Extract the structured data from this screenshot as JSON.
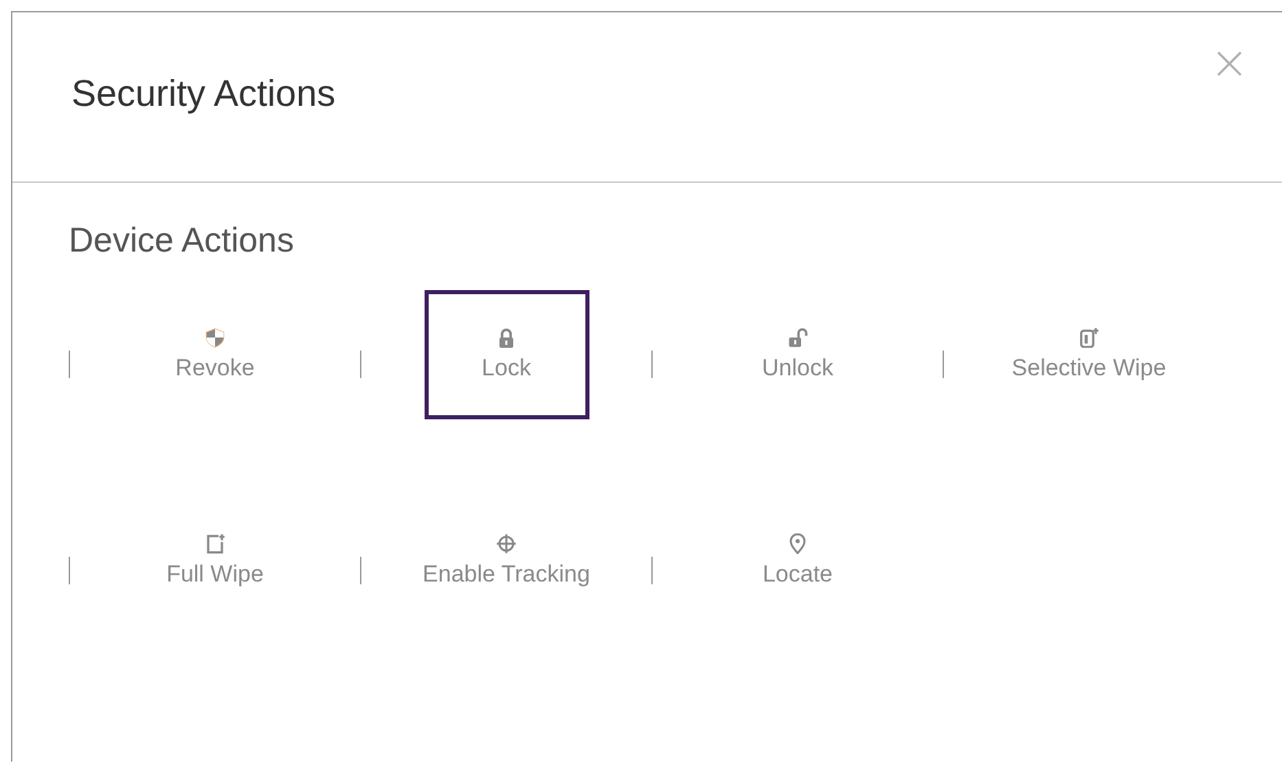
{
  "dialog": {
    "title": "Security Actions",
    "close": "×"
  },
  "section": {
    "title": "Device Actions"
  },
  "actions": [
    {
      "label": "Revoke",
      "kind": "shield",
      "selected": false
    },
    {
      "label": "Lock",
      "kind": "lock",
      "selected": true
    },
    {
      "label": "Unlock",
      "kind": "unlock",
      "selected": false
    },
    {
      "label": "Selective Wipe",
      "kind": "phone",
      "selected": false
    },
    {
      "label": "Full Wipe",
      "kind": "document",
      "selected": false
    },
    {
      "label": "Enable Tracking",
      "kind": "crosshair",
      "selected": false
    },
    {
      "label": "Locate",
      "kind": "pin",
      "selected": false
    }
  ]
}
